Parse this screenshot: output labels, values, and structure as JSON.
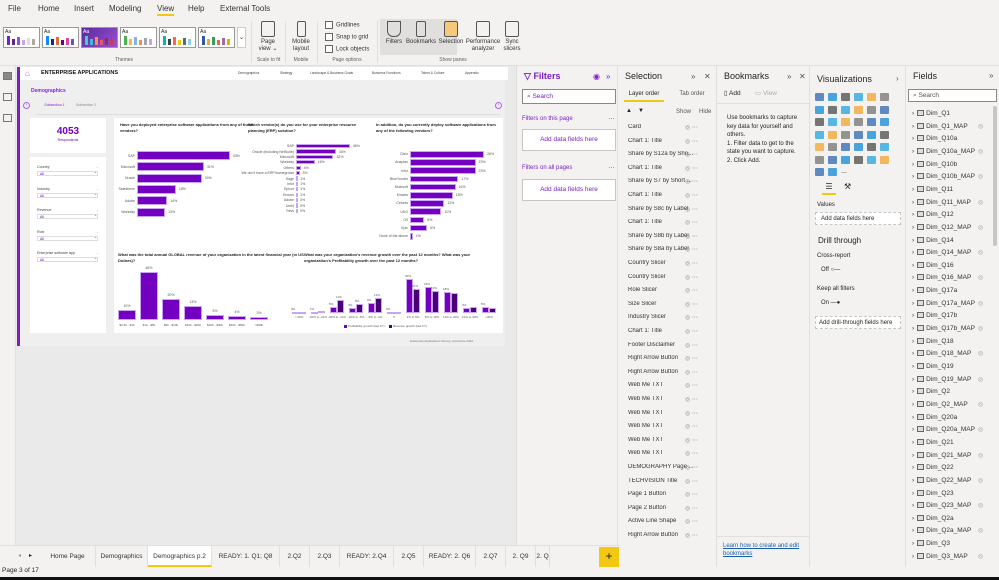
{
  "menu": [
    "File",
    "Home",
    "Insert",
    "Modeling",
    "View",
    "Help",
    "External Tools"
  ],
  "active_menu": "View",
  "ribbon": {
    "theme_sample": "Aa",
    "groups": {
      "themes": "Themes",
      "scale": "Scale to fit",
      "mobile": "Mobile",
      "page_options": "Page options",
      "show_panes": "Show panes"
    },
    "page_view": "Page view",
    "mobile_layout": "Mobile layout",
    "checkboxes": [
      "Gridlines",
      "Snap to grid",
      "Lock objects"
    ],
    "pane_buttons": [
      "Filters",
      "Bookmarks",
      "Selection",
      "Performance analyzer",
      "Sync slicers"
    ]
  },
  "report": {
    "brand": "ENTERPRISE APPLICATIONS",
    "nav": [
      "Demographics",
      "Strategy",
      "Landscape & Business Goals",
      "Business Functions",
      "Talent & Culture",
      "Appendix"
    ],
    "section_title": "Demographics",
    "subsections": [
      "Subsection 1",
      "Subsection 2"
    ],
    "card_value": "4053",
    "card_label": "Respondents",
    "slicers": [
      {
        "label": "Country",
        "value": "All"
      },
      {
        "label": "Industry",
        "value": "All"
      },
      {
        "label": "Revenue",
        "value": "All"
      },
      {
        "label": "Role",
        "value": "All"
      },
      {
        "label": "Enterprise software app",
        "value": "All"
      }
    ],
    "footer": "Enterprise Applications Survey, Accenture 2022",
    "accent": "#7300c0",
    "accent_dark": "#4b0077"
  },
  "chart_data": [
    {
      "type": "bar",
      "orientation": "horizontal",
      "title": "Have you deployed enterprise software applications from any of these vendors?",
      "categories": [
        "SAP",
        "Microsoft",
        "Oracle",
        "Salesforce",
        "Adobe",
        "Workday"
      ],
      "values": [
        43,
        31,
        30,
        18,
        14,
        13
      ],
      "unit": "%"
    },
    {
      "type": "bar",
      "orientation": "horizontal",
      "title": "Which vendor(s) do you use for your enterprise resource planning (ERP) solution?",
      "categories": [
        "SAP",
        "Oracle (including NetSuite)",
        "Microsoft",
        "Workday",
        "Others",
        "We don't have a ERP/homegrown",
        "Sage",
        "Infor",
        "Epicor",
        "Kronos",
        "Adobe",
        "Unit4",
        "Totvs"
      ],
      "values": [
        46,
        34,
        32,
        16,
        4,
        3,
        1,
        1,
        1,
        1,
        0,
        0,
        0
      ],
      "unit": "%"
    },
    {
      "type": "bar",
      "orientation": "horizontal",
      "title": "In addition, do you currently deploy software applications from any of the following vendors?",
      "categories": [
        "Citrix",
        "Anaplan",
        "Infor",
        "BlueYonder",
        "Mulesoft",
        "Kinaxis",
        "Celonis",
        "UKG",
        "O9",
        "Epic",
        "None of the above"
      ],
      "values": [
        26,
        23,
        23,
        17,
        16,
        15,
        12,
        11,
        5,
        6,
        1
      ],
      "unit": "%"
    },
    {
      "type": "bar",
      "orientation": "vertical",
      "title": "What was the total annual GLOBAL revenue of your organization in the latest financial year (in US Dollars)?",
      "categories": [
        "$0.5b - $1b",
        "$1b - $5b",
        "$5b - $10b",
        "$10b - $20b",
        "$20b - $30b",
        "$30b - $50b",
        ">$50b"
      ],
      "values": [
        10,
        46,
        20,
        13,
        5,
        4,
        3
      ],
      "unit": "%"
    },
    {
      "type": "bar",
      "orientation": "vertical",
      "title": "What was your organization's revenue growth over the past 12 months? What was your organization's Profitability growth over the past 12 months?",
      "categories": [
        "<-30%",
        "-30% to -21%",
        "-20% to -11%",
        "-10% to -6%",
        "-5% to -1%",
        "0",
        "1% to 5%",
        "6% to 10%",
        "11% to 20%",
        "21% to 30%",
        ">30%"
      ],
      "series": [
        {
          "name": "Profitability growth (last FY)",
          "values": [
            0,
            1,
            5,
            4,
            9,
            0,
            30,
            23,
            18,
            4,
            5
          ],
          "color": "#7300c0"
        },
        {
          "name": "Revenue growth (last FY)",
          "values": [
            1,
            1.5,
            11,
            8,
            13,
            0,
            21,
            19,
            17,
            5,
            4
          ],
          "color": "#4b0077"
        }
      ],
      "labels": [
        [
          "0%",
          "1%",
          "5%",
          "4%",
          "9%",
          "0%",
          "30%",
          "23%",
          "18%",
          "4%",
          "5%"
        ],
        [
          "",
          "",
          "11%",
          "8%",
          "13%",
          "",
          "21%",
          "19%",
          "",
          "",
          ""
        ]
      ],
      "legend": "bottom",
      "unit": "%"
    }
  ],
  "filters": {
    "title": "Filters",
    "search": "Search",
    "this_page": "Filters on this page",
    "all_pages": "Filters on all pages",
    "add": "Add data fields here"
  },
  "selection": {
    "title": "Selection",
    "tabs": [
      "Layer order",
      "Tab order"
    ],
    "show": "Show",
    "hide": "Hide",
    "items": [
      "Card",
      "Chart 1: Title",
      "Share by S12a by Sho...",
      "Chart 1: Title",
      "Share by S7 by Short ...",
      "Chart 1: Title",
      "Share by S8c by Label",
      "Chart 1: Title",
      "Share by S8b by Label",
      "Share by S8a by Label",
      "Country Slicer",
      "Country Slicer",
      "Role Slicer",
      "Size Slicer",
      "Industry Slicer",
      "Chart 1: Title",
      "Footer Disclaimer",
      "Right Arrow Button",
      "Right Arrow Button",
      "Web Me TXT",
      "Web Me TXT",
      "Web Me TXT",
      "Web Me TXT",
      "Web Me TXT",
      "Web Me TXT",
      "DEMOGRAPHY  Page ...",
      "TECHVISION Title",
      "Page 1 Button",
      "Page 2 Button",
      "Active Line Shape",
      "Right Arrow Button"
    ]
  },
  "bookmarks": {
    "title": "Bookmarks",
    "add": "Add",
    "view": "View",
    "help": "Use bookmarks to capture key data for yourself and others.\n1. Filter data to get to the state you want to capture.\n2. Click Add.",
    "link": "Learn how to create and edit bookmarks"
  },
  "visualizations": {
    "title": "Visualizations",
    "values": "Values",
    "add": "Add data fields here",
    "drill": "Drill through",
    "cross": "Cross-report",
    "cross_state": "Off",
    "keep": "Keep all filters",
    "keep_state": "On",
    "add_drill": "Add drill-through fields here",
    "more": "..."
  },
  "fields": {
    "title": "Fields",
    "search": "Search",
    "items": [
      [
        "Dim_Q1",
        false
      ],
      [
        "Dim_Q1_MAP",
        true
      ],
      [
        "Dim_Q10a",
        false
      ],
      [
        "Dim_Q10a_MAP",
        true
      ],
      [
        "Dim_Q10b",
        false
      ],
      [
        "Dim_Q10b_MAP",
        true
      ],
      [
        "Dim_Q11",
        false
      ],
      [
        "Dim_Q11_MAP",
        true
      ],
      [
        "Dim_Q12",
        false
      ],
      [
        "Dim_Q12_MAP",
        true
      ],
      [
        "Dim_Q14",
        false
      ],
      [
        "Dim_Q14_MAP",
        true
      ],
      [
        "Dim_Q16",
        false
      ],
      [
        "Dim_Q16_MAP",
        true
      ],
      [
        "Dim_Q17a",
        false
      ],
      [
        "Dim_Q17a_MAP",
        true
      ],
      [
        "Dim_Q17b",
        false
      ],
      [
        "Dim_Q17b_MAP",
        true
      ],
      [
        "Dim_Q18",
        false
      ],
      [
        "Dim_Q18_MAP",
        true
      ],
      [
        "Dim_Q19",
        false
      ],
      [
        "Dim_Q19_MAP",
        true
      ],
      [
        "Dim_Q2",
        false
      ],
      [
        "Dim_Q2_MAP",
        true
      ],
      [
        "Dim_Q20a",
        false
      ],
      [
        "Dim_Q20a_MAP",
        true
      ],
      [
        "Dim_Q21",
        false
      ],
      [
        "Dim_Q21_MAP",
        true
      ],
      [
        "Dim_Q22",
        false
      ],
      [
        "Dim_Q22_MAP",
        true
      ],
      [
        "Dim_Q23",
        false
      ],
      [
        "Dim_Q23_MAP",
        true
      ],
      [
        "Dim_Q2a",
        false
      ],
      [
        "Dim_Q2a_MAP",
        true
      ],
      [
        "Dim_Q3",
        false
      ],
      [
        "Dim_Q3_MAP",
        true
      ]
    ]
  },
  "page_tabs": [
    "Home Page",
    "Demographics",
    "Demographics p.2",
    "READY: 1. Q1; Q8",
    "2.Q2",
    "2.Q3",
    "READY: 2.Q4",
    "2.Q5",
    "READY: 2. Q6",
    "2.Q7",
    "2. Q9",
    "2. Q"
  ],
  "active_tab": "Demographics p.2",
  "status": "Page 3 of 17"
}
